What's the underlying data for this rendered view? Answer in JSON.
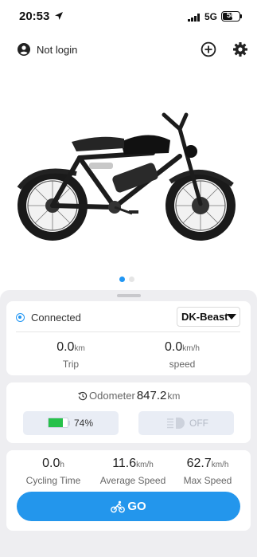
{
  "status_bar": {
    "time": "20:53",
    "network": "5G",
    "battery": "50"
  },
  "header": {
    "user_label": "Not login",
    "add_icon": "plus-circle-icon",
    "settings_icon": "gear-icon"
  },
  "carousel": {
    "pages": 2,
    "active": 0
  },
  "connection": {
    "status": "Connected",
    "device": "DK-Beast"
  },
  "trip": {
    "trip_value": "0.0",
    "trip_unit": "km",
    "trip_label": "Trip",
    "speed_value": "0.0",
    "speed_unit": "km/h",
    "speed_label": "speed"
  },
  "odometer": {
    "label": "Odometer",
    "value": "847.2",
    "unit": "km"
  },
  "battery": {
    "percent_label": "74%",
    "level": 0.74
  },
  "light": {
    "state": "OFF"
  },
  "stats": {
    "cycling_value": "0.0",
    "cycling_unit": "h",
    "cycling_label": "Cycling Time",
    "avg_value": "11.6",
    "avg_unit": "km/h",
    "avg_label": "Average Speed",
    "max_value": "62.7",
    "max_unit": "km/h",
    "max_label": "Max Speed"
  },
  "go_button": {
    "label": "GO"
  },
  "colors": {
    "accent": "#2396ec",
    "battery_green": "#27c14b",
    "panel_bg": "#eeeef1"
  }
}
